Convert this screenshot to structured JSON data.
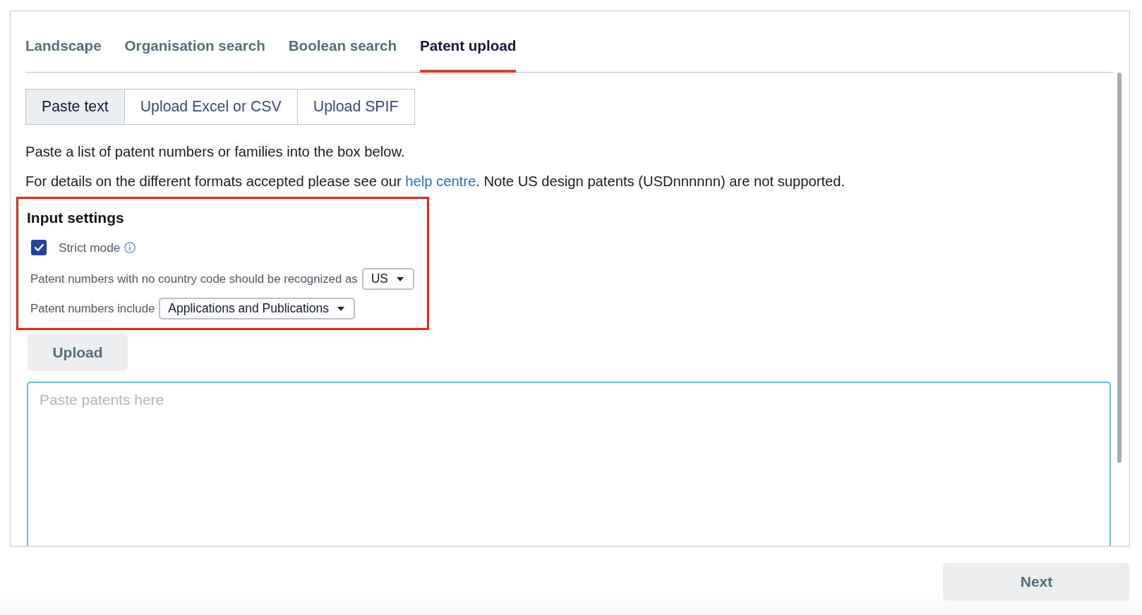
{
  "tabs": [
    {
      "label": "Landscape",
      "selected": false
    },
    {
      "label": "Organisation search",
      "selected": false
    },
    {
      "label": "Boolean search",
      "selected": false
    },
    {
      "label": "Patent upload",
      "selected": true
    }
  ],
  "input_modes": [
    {
      "label": "Paste text",
      "selected": true
    },
    {
      "label": "Upload Excel or CSV",
      "selected": false
    },
    {
      "label": "Upload SPIF",
      "selected": false
    }
  ],
  "intro_text": "Paste a list of patent numbers or families into the box below.",
  "help_text": {
    "before": "For details on the different formats accepted please see our ",
    "link": "help centre",
    "after": ". Note US design patents (USDnnnnnn) are not supported."
  },
  "input_settings": {
    "highlighted": true,
    "title": "Input settings",
    "strict_mode": {
      "label": "Strict mode",
      "checked": true
    },
    "country_code": {
      "label": "Patent numbers with no country code should be recognized as",
      "value": "US"
    },
    "include": {
      "label": "Patent numbers include",
      "value": "Applications and Publications"
    }
  },
  "upload_button": "Upload",
  "patents_field": {
    "placeholder": "Paste patents here"
  },
  "next_button": "Next"
}
